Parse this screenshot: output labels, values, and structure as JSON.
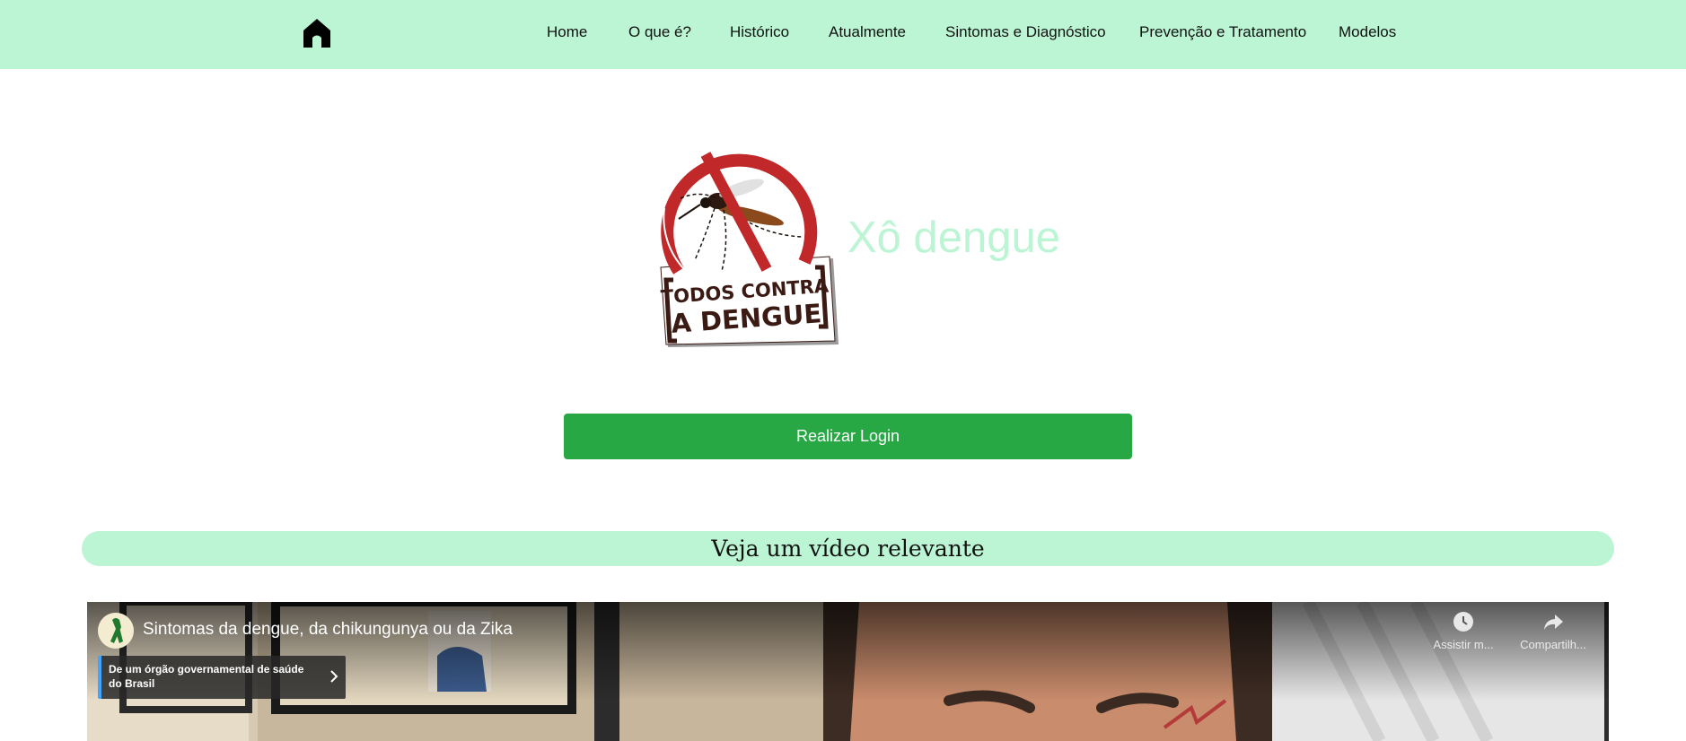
{
  "nav": {
    "home_icon": "home-icon",
    "links": [
      "Home",
      "O que é?",
      "Histórico",
      "Atualmente",
      "Sintomas e Diagnóstico",
      "Prevenção e Tratamento",
      "Modelos"
    ]
  },
  "hero": {
    "logo_text": [
      "TODOS CONTRA",
      "A DENGUE"
    ],
    "title": "Xô dengue"
  },
  "login": {
    "label": "Realizar Login"
  },
  "video_section": {
    "heading": "Veja um vídeo relevante"
  },
  "video": {
    "title": "Sintomas da dengue, da chikungunya ou da Zika",
    "info_card": "De um órgão governamental de saúde do Brasil",
    "actions": [
      "Assistir m...",
      "Compartilh..."
    ]
  },
  "colors": {
    "navbar": "#bbf5d3",
    "accent_green": "#28a745",
    "title_green": "#bbf5d3",
    "logo_red": "#c0282a",
    "logo_dark": "#3b1a14"
  }
}
